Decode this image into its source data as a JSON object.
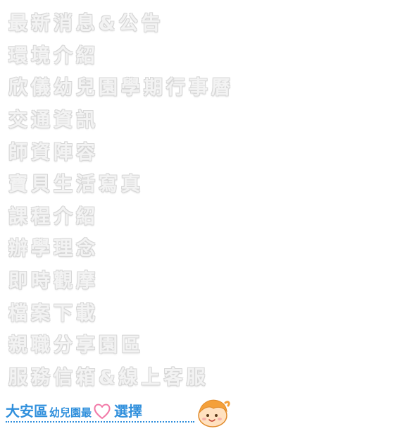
{
  "menu": {
    "items": [
      {
        "label": "最新消息&公告"
      },
      {
        "label": "環境介紹"
      },
      {
        "label": "欣儀幼兒園學期行事曆"
      },
      {
        "label": "交通資訊"
      },
      {
        "label": "師資陣容"
      },
      {
        "label": "寶貝生活寫真"
      },
      {
        "label": "課程介紹"
      },
      {
        "label": "辦學理念"
      },
      {
        "label": "即時觀摩"
      },
      {
        "label": "檔案下載"
      },
      {
        "label": "親職分享園區"
      },
      {
        "label": "服務信箱&線上客服"
      }
    ]
  },
  "slogan": {
    "part1": "大安區",
    "part2": "幼兒園最",
    "part3": "選擇",
    "heart_icon": "heart-outline-icon",
    "mascot_icon": "child-face-mascot-icon"
  },
  "colors": {
    "menu_text_fill": "#f3f3f3",
    "menu_text_outline": "#d7d7d7",
    "slogan_blue": "#2f8fdc",
    "heart_pink": "#f27aa8",
    "mascot_hair": "#f4a03a",
    "mascot_face": "#ffe1c0"
  }
}
